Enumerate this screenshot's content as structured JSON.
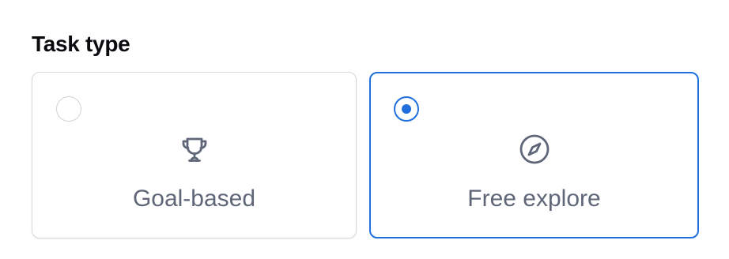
{
  "task_type": {
    "title": "Task type",
    "options": [
      {
        "label": "Goal-based",
        "icon": "trophy-icon",
        "selected": false
      },
      {
        "label": "Free explore",
        "icon": "compass-icon",
        "selected": true
      }
    ]
  },
  "colors": {
    "accent": "#1f6fde",
    "icon": "#5f6678",
    "border": "#d4d7dc",
    "title": "#0b0b0f"
  }
}
